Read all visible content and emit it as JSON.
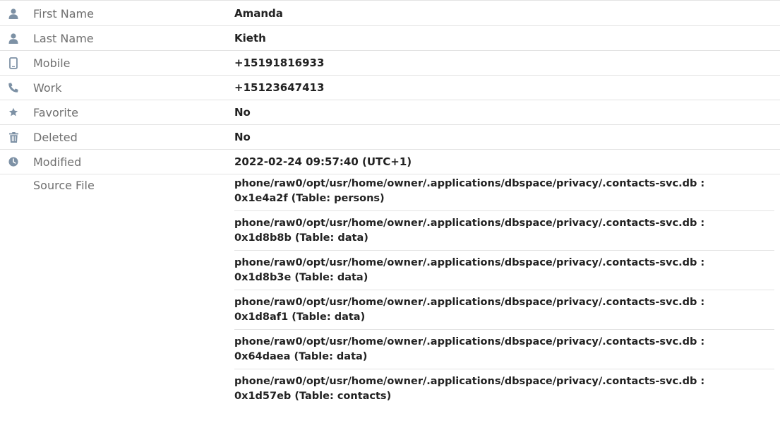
{
  "colors": {
    "icon": "#7d91a5",
    "label": "#6f6f6f",
    "value": "#222222",
    "divider": "#e3e3e3"
  },
  "fields": [
    {
      "icon": "user-icon",
      "label": "First Name",
      "value": "Amanda"
    },
    {
      "icon": "user-icon",
      "label": "Last Name",
      "value": "Kieth"
    },
    {
      "icon": "mobile-phone-icon",
      "label": "Mobile",
      "value": "+15191816933"
    },
    {
      "icon": "phone-icon",
      "label": "Work",
      "value": "+15123647413"
    },
    {
      "icon": "star-icon",
      "label": "Favorite",
      "value": "No"
    },
    {
      "icon": "trash-icon",
      "label": "Deleted",
      "value": "No"
    },
    {
      "icon": "clock-icon",
      "label": "Modified",
      "value": "2022-02-24 09:57:40 (UTC+1)"
    }
  ],
  "source_file": {
    "label": "Source File",
    "entries": [
      {
        "path": "phone/raw0/opt/usr/home/owner/.applications/dbspace/privacy/.contacts-svc.db :",
        "offset": "0x1e4a2f (Table: persons)"
      },
      {
        "path": "phone/raw0/opt/usr/home/owner/.applications/dbspace/privacy/.contacts-svc.db :",
        "offset": "0x1d8b8b (Table: data)"
      },
      {
        "path": "phone/raw0/opt/usr/home/owner/.applications/dbspace/privacy/.contacts-svc.db :",
        "offset": "0x1d8b3e (Table: data)"
      },
      {
        "path": "phone/raw0/opt/usr/home/owner/.applications/dbspace/privacy/.contacts-svc.db :",
        "offset": "0x1d8af1 (Table: data)"
      },
      {
        "path": "phone/raw0/opt/usr/home/owner/.applications/dbspace/privacy/.contacts-svc.db :",
        "offset": "0x64daea (Table: data)"
      },
      {
        "path": "phone/raw0/opt/usr/home/owner/.applications/dbspace/privacy/.contacts-svc.db :",
        "offset": "0x1d57eb (Table: contacts)"
      }
    ]
  }
}
